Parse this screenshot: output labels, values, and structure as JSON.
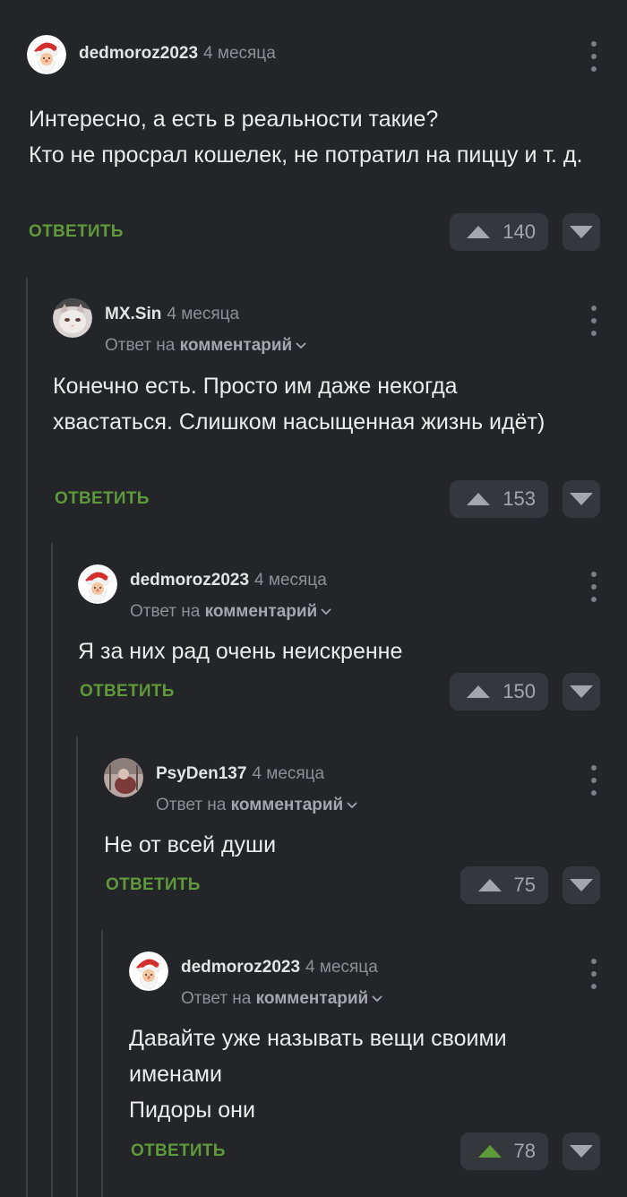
{
  "comments": [
    {
      "author": "dedmoroz2023",
      "time": "4 месяца",
      "avatar_icon": "santa-avatar",
      "text": "Интересно, а есть в реальности такие?\nКто не просрал кошелек, не потратил на пиццу и т. д.",
      "reply_label": "ОТВЕТИТЬ",
      "votes": "140",
      "upvoted": false
    },
    {
      "author": "MX.Sin",
      "time": "4 месяца",
      "avatar_icon": "cat-avatar",
      "reply_prefix": "Ответ на",
      "reply_target": "комментарий",
      "text": "Конечно есть. Просто им даже некогда хвастаться. Слишком насыщенная жизнь идёт)",
      "reply_label": "ОТВЕТИТЬ",
      "votes": "153",
      "upvoted": false
    },
    {
      "author": "dedmoroz2023",
      "time": "4 месяца",
      "avatar_icon": "santa-avatar",
      "reply_prefix": "Ответ на",
      "reply_target": "комментарий",
      "text": "Я за них рад очень неискренне",
      "reply_label": "ОТВЕТИТЬ",
      "votes": "150",
      "upvoted": false
    },
    {
      "author": "PsyDen137",
      "time": "4 месяца",
      "avatar_icon": "photo-avatar",
      "reply_prefix": "Ответ на",
      "reply_target": "комментарий",
      "text": "Не от всей души",
      "reply_label": "ОТВЕТИТЬ",
      "votes": "75",
      "upvoted": false
    },
    {
      "author": "dedmoroz2023",
      "time": "4 месяца",
      "avatar_icon": "santa-avatar",
      "reply_prefix": "Ответ на",
      "reply_target": "комментарий",
      "text": "Давайте уже называть вещи своими именами\nПидоры они",
      "reply_label": "ОТВЕТИТЬ",
      "votes": "78",
      "upvoted": true
    }
  ],
  "colors": {
    "background": "#232528",
    "reply_green": "#5f9a3a",
    "upvote_active": "#5f9a3a",
    "button_bg": "#34373b",
    "muted_text": "#8d9094"
  }
}
